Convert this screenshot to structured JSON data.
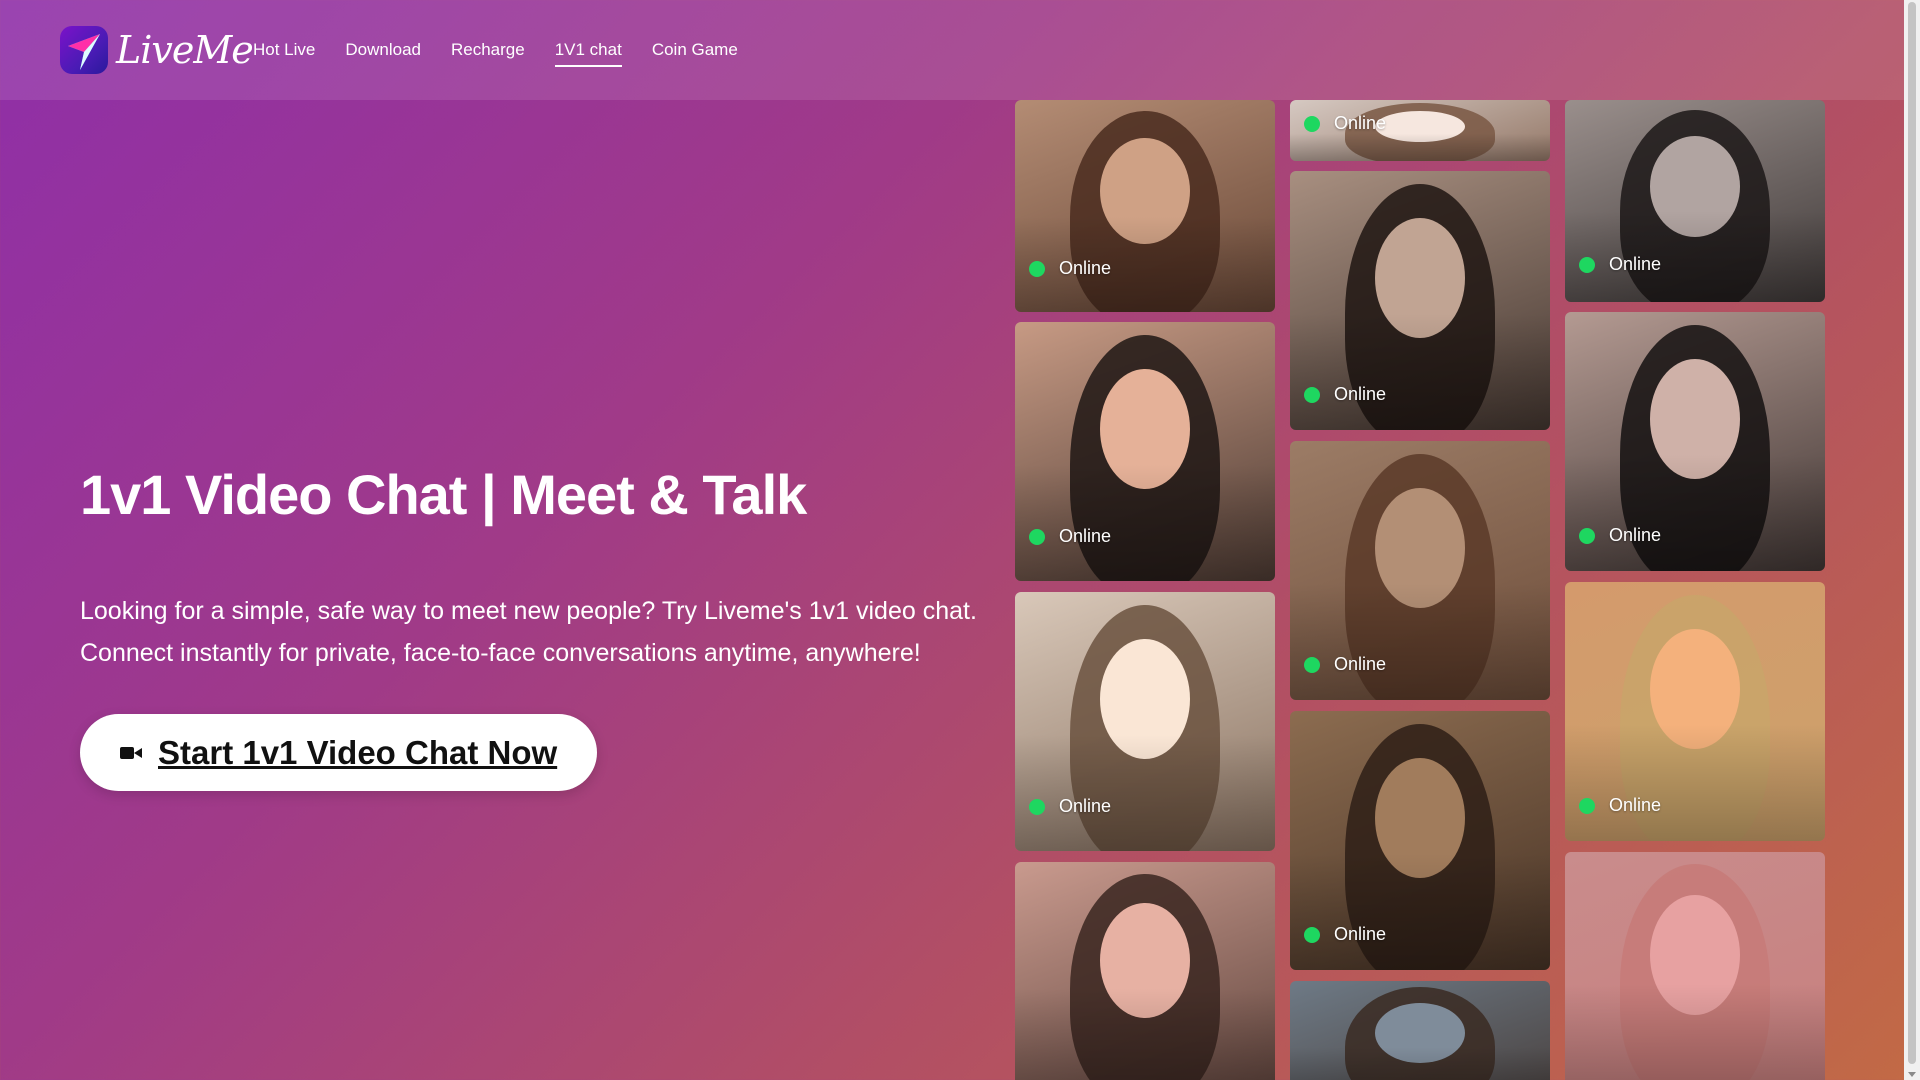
{
  "brand": {
    "name": "LiveMe"
  },
  "nav": {
    "items": [
      {
        "label": "Hot Live",
        "active": false
      },
      {
        "label": "Download",
        "active": false
      },
      {
        "label": "Recharge",
        "active": false
      },
      {
        "label": "1V1 chat",
        "active": true
      },
      {
        "label": "Coin Game",
        "active": false
      }
    ]
  },
  "hero": {
    "title": "1v1 Video Chat | Meet & Talk",
    "description": "Looking for a simple, safe way to meet new people? Try Liveme's 1v1 video chat. Connect instantly for private, face-to-face conversations anytime, anywhere!",
    "cta_label": "Start 1v1 Video Chat Now",
    "cta_icon": "video-camera-icon"
  },
  "profiles": {
    "status_label": "Online",
    "status_color": "#1ed760",
    "columns": [
      [
        {
          "status": "Online",
          "tone": "#b48c74",
          "hair": "#4a2c1e"
        },
        {
          "status": "Online",
          "tone": "#c79a84",
          "hair": "#1e1614"
        },
        {
          "status": "Online",
          "tone": "#d9c8b9",
          "hair": "#6b5240"
        },
        {
          "status": "",
          "tone": "#c99a8e",
          "hair": "#3a2620"
        }
      ],
      [
        {
          "status": "Online",
          "tone": "#d6c9c2",
          "hair": "#7a5844"
        },
        {
          "status": "Online",
          "tone": "#a88f80",
          "hair": "#1e1512"
        },
        {
          "status": "Online",
          "tone": "#9c7c66",
          "hair": "#5a3a28"
        },
        {
          "status": "Online",
          "tone": "#8c6c50",
          "hair": "#2e1e16"
        },
        {
          "status": "",
          "tone": "#6e7a86",
          "hair": "#3a2a22"
        }
      ],
      [
        {
          "status": "Online",
          "tone": "#9a8f8c",
          "hair": "#1c1818"
        },
        {
          "status": "Online",
          "tone": "#b49a92",
          "hair": "#141010"
        },
        {
          "status": "Online",
          "tone": "#d49a6c",
          "hair": "#c9a56a"
        },
        {
          "status": "",
          "tone": "#c98c8c",
          "hair": "#c77a78"
        }
      ]
    ]
  }
}
